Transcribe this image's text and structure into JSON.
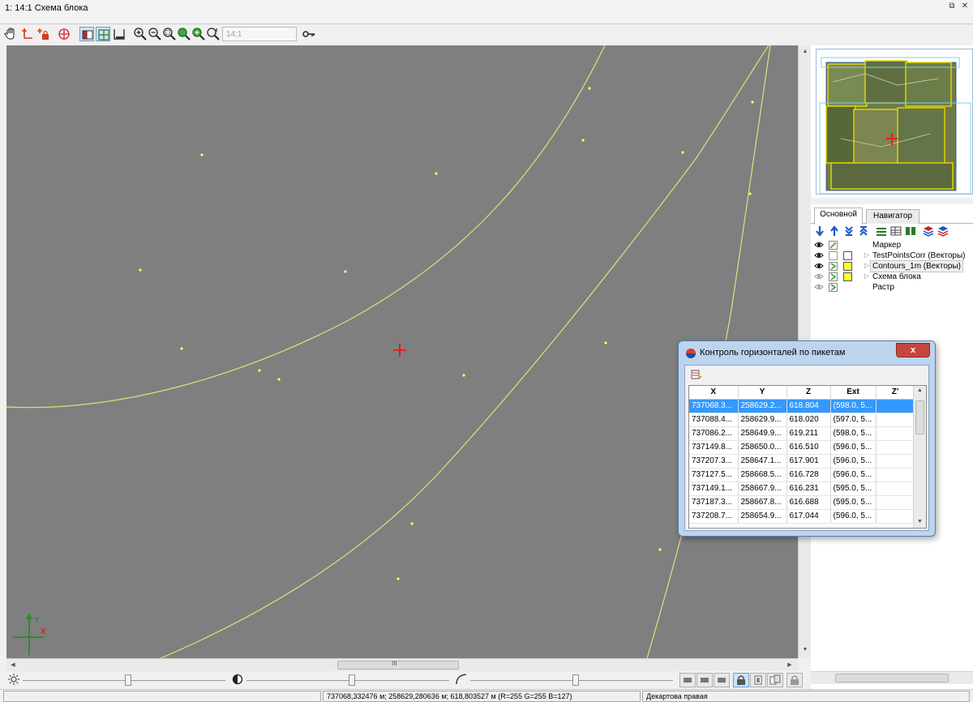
{
  "window": {
    "title": "1: 14:1 Схема блока",
    "restore_glyph": "⧉",
    "close_glyph": "✕"
  },
  "toolbar": {
    "scale_value": "14:1",
    "tools": [
      "pan-hand-icon",
      "add-point-icon",
      "add-locked-point-icon",
      "grid-icon",
      "mode-raster-icon",
      "mode-vector-icon",
      "mode-frame-icon",
      "zoom-in-icon",
      "zoom-out-icon",
      "zoom-window-icon",
      "zoom-full-icon",
      "zoom-layer-icon",
      "zoom-previous-icon",
      "key-icon"
    ]
  },
  "map": {
    "background": "#7f7f7f",
    "contour_color": "#e0e07a",
    "point_color": "#ffff66",
    "cursor_color": "#ff0000",
    "axis_color": "#2e8b2e",
    "axis_labels": {
      "y": "Y",
      "x": "X"
    }
  },
  "hscroll": {
    "thumb_glyph": "III"
  },
  "right_panel": {
    "tabs": [
      {
        "label": "Основной",
        "active": true
      },
      {
        "label": "Навигатор",
        "active": false
      }
    ],
    "layer_tools": [
      "move-down-icon",
      "move-up-icon",
      "move-bottom-icon",
      "move-top-icon",
      "layer-props-icon",
      "layer-table-icon",
      "layer-columns-icon",
      "layers-stack-icon",
      "layers-stack-alt-icon"
    ],
    "layers": [
      {
        "name": "Маркер",
        "eye": true,
        "editable": true,
        "has_box": false,
        "expandable": false,
        "selected": false
      },
      {
        "name": "TestPointsCorr (Векторы)",
        "eye": true,
        "editable": false,
        "has_box": true,
        "box_color": "#ffffff",
        "expandable": true,
        "selected": false
      },
      {
        "name": "Contours_1m (Векторы)",
        "eye": true,
        "editable": true,
        "has_box": true,
        "box_color": "#ffff33",
        "expandable": true,
        "selected": true
      },
      {
        "name": "Схема блока",
        "eye": false,
        "editable": true,
        "has_box": true,
        "box_color": "#ffff33",
        "expandable": true,
        "selected": false
      },
      {
        "name": "Растр",
        "eye": false,
        "editable": true,
        "has_box": false,
        "expandable": false,
        "selected": false
      }
    ],
    "scroll_glyph": "III"
  },
  "dialog": {
    "title": "Контроль горизонталей по пикетам",
    "close_glyph": "x",
    "columns": [
      "X",
      "Y",
      "Z",
      "Ext",
      "Z'"
    ],
    "rows": [
      [
        "737068.3...",
        "258629.2...",
        "618.804",
        "(598.0, 5...",
        ""
      ],
      [
        "737088.4...",
        "258629.9...",
        "618.020",
        "(597.0, 5...",
        ""
      ],
      [
        "737086.2...",
        "258649.9...",
        "619.211",
        "(598.0, 5...",
        ""
      ],
      [
        "737149.8...",
        "258650.0...",
        "616.510",
        "(596.0, 5...",
        ""
      ],
      [
        "737207.3...",
        "258647.1...",
        "617.901",
        "(596.0, 5...",
        ""
      ],
      [
        "737127.5...",
        "258668.5...",
        "616.728",
        "(596.0, 5...",
        ""
      ],
      [
        "737149.1...",
        "258667.9...",
        "616.231",
        "(595.0, 5...",
        ""
      ],
      [
        "737187.3...",
        "258667.8...",
        "616.688",
        "(595.0, 5...",
        ""
      ],
      [
        "737208.7...",
        "258654.9...",
        "617.044",
        "(596.0, 5...",
        ""
      ]
    ],
    "selected_row": 0
  },
  "sliders": {
    "brightness_level": 0.52,
    "contrast_level": 0.52,
    "gamma_level": 0.52
  },
  "status": {
    "coords": "737068,332476 м; 258629,280636 м; 618,803527 м   (R=255 G=255 B=127)",
    "projection": "Декартова правая"
  }
}
